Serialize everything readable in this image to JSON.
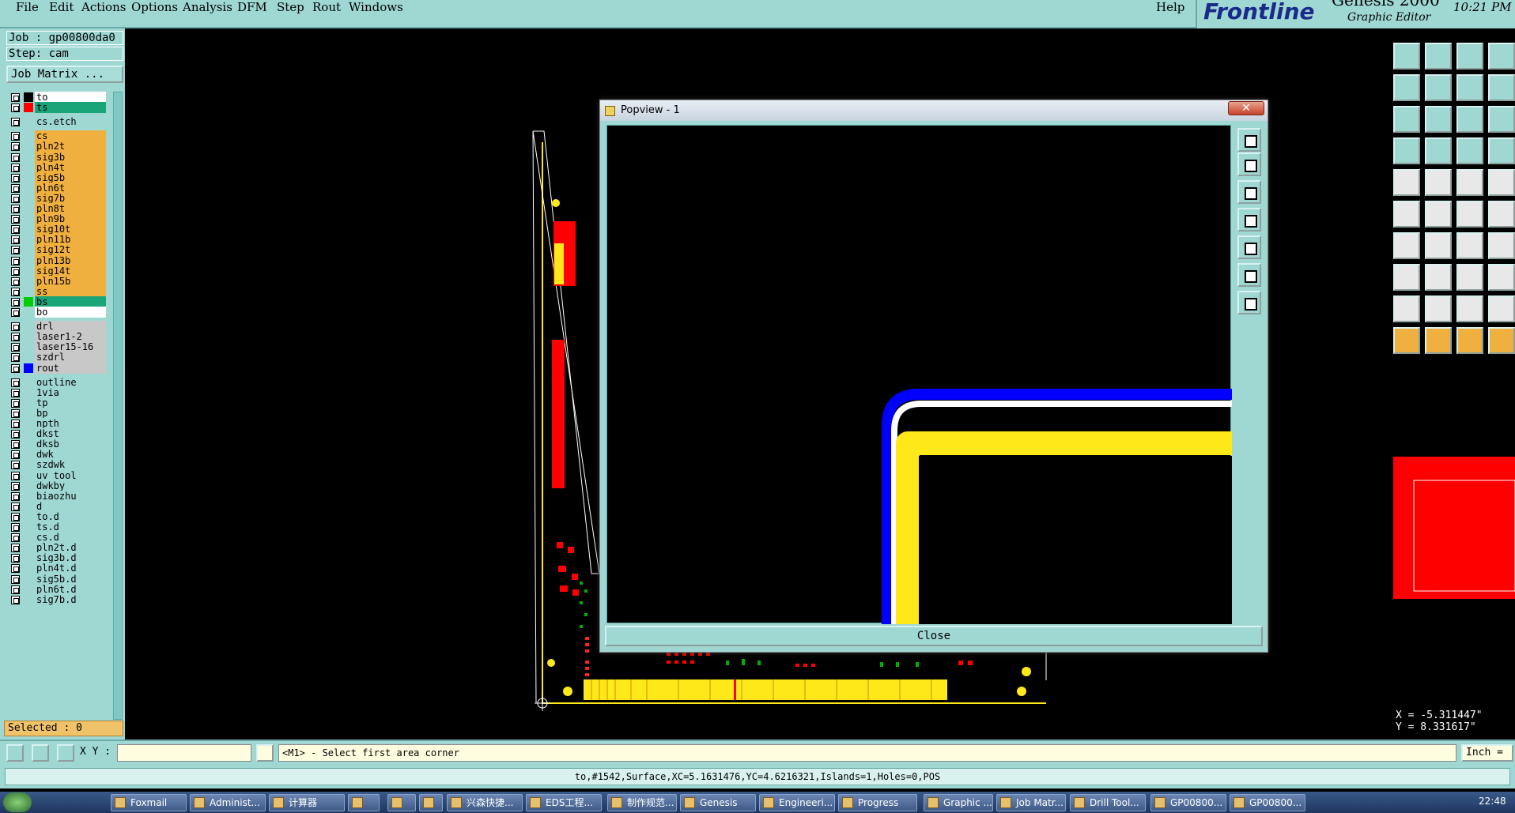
{
  "menu": {
    "items": [
      "File",
      "Edit",
      "Actions",
      "Options",
      "Analysis",
      "DFM",
      "Step",
      "Rout",
      "Windows"
    ],
    "help": "Help"
  },
  "brand": {
    "logo": "Frontline",
    "product": "Genesis 2000",
    "subtitle": "Graphic Editor",
    "clock": "10:21 PM"
  },
  "left": {
    "job": "Job : gp00800da0",
    "step": "Step: cam",
    "job_matrix": "Job Matrix ...",
    "selected": "Selected : 0",
    "layers": [
      {
        "name": "to",
        "bg": "#ffffff",
        "color": "#000000"
      },
      {
        "name": "ts",
        "bg": "#1aa579",
        "color": "#ff0000"
      },
      {
        "name": "cs.etch",
        "bg": "#9fd7d3",
        "color": ""
      },
      {
        "name": "cs",
        "bg": "#f0b040",
        "color": ""
      },
      {
        "name": "pln2t",
        "bg": "#f0b040",
        "color": ""
      },
      {
        "name": "sig3b",
        "bg": "#f0b040",
        "color": ""
      },
      {
        "name": "pln4t",
        "bg": "#f0b040",
        "color": ""
      },
      {
        "name": "sig5b",
        "bg": "#f0b040",
        "color": ""
      },
      {
        "name": "pln6t",
        "bg": "#f0b040",
        "color": ""
      },
      {
        "name": "sig7b",
        "bg": "#f0b040",
        "color": ""
      },
      {
        "name": "pln8t",
        "bg": "#f0b040",
        "color": ""
      },
      {
        "name": "pln9b",
        "bg": "#f0b040",
        "color": ""
      },
      {
        "name": "sig10t",
        "bg": "#f0b040",
        "color": ""
      },
      {
        "name": "pln11b",
        "bg": "#f0b040",
        "color": ""
      },
      {
        "name": "sig12t",
        "bg": "#f0b040",
        "color": ""
      },
      {
        "name": "pln13b",
        "bg": "#f0b040",
        "color": ""
      },
      {
        "name": "sig14t",
        "bg": "#f0b040",
        "color": ""
      },
      {
        "name": "pln15b",
        "bg": "#f0b040",
        "color": ""
      },
      {
        "name": "ss",
        "bg": "#f0b040",
        "color": ""
      },
      {
        "name": "bs",
        "bg": "#1aa579",
        "color": "#00cc00"
      },
      {
        "name": "bo",
        "bg": "#ffffff",
        "color": ""
      },
      {
        "name": "drl",
        "bg": "#c8c8c8",
        "color": ""
      },
      {
        "name": "laser1-2",
        "bg": "#c8c8c8",
        "color": ""
      },
      {
        "name": "laser15-16",
        "bg": "#c8c8c8",
        "color": ""
      },
      {
        "name": "szdrl",
        "bg": "#c8c8c8",
        "color": ""
      },
      {
        "name": "rout",
        "bg": "#c8c8c8",
        "color": "#0000ff"
      },
      {
        "name": "outline",
        "bg": "#9fd7d3",
        "color": ""
      },
      {
        "name": "1via",
        "bg": "#9fd7d3",
        "color": ""
      },
      {
        "name": "tp",
        "bg": "#9fd7d3",
        "color": ""
      },
      {
        "name": "bp",
        "bg": "#9fd7d3",
        "color": ""
      },
      {
        "name": "npth",
        "bg": "#9fd7d3",
        "color": ""
      },
      {
        "name": "dkst",
        "bg": "#9fd7d3",
        "color": ""
      },
      {
        "name": "dksb",
        "bg": "#9fd7d3",
        "color": ""
      },
      {
        "name": "dwk",
        "bg": "#9fd7d3",
        "color": ""
      },
      {
        "name": "szdwk",
        "bg": "#9fd7d3",
        "color": ""
      },
      {
        "name": "uv_tool",
        "bg": "#9fd7d3",
        "color": ""
      },
      {
        "name": "dwkby",
        "bg": "#9fd7d3",
        "color": ""
      },
      {
        "name": "biaozhu",
        "bg": "#9fd7d3",
        "color": ""
      },
      {
        "name": "d",
        "bg": "#9fd7d3",
        "color": ""
      },
      {
        "name": "to.d",
        "bg": "#9fd7d3",
        "color": ""
      },
      {
        "name": "ts.d",
        "bg": "#9fd7d3",
        "color": ""
      },
      {
        "name": "cs.d",
        "bg": "#9fd7d3",
        "color": ""
      },
      {
        "name": "pln2t.d",
        "bg": "#9fd7d3",
        "color": ""
      },
      {
        "name": "sig3b.d",
        "bg": "#9fd7d3",
        "color": ""
      },
      {
        "name": "pln4t.d",
        "bg": "#9fd7d3",
        "color": ""
      },
      {
        "name": "sig5b.d",
        "bg": "#9fd7d3",
        "color": ""
      },
      {
        "name": "pln6t.d",
        "bg": "#9fd7d3",
        "color": ""
      },
      {
        "name": "sig7b.d",
        "bg": "#9fd7d3",
        "color": ""
      }
    ]
  },
  "popup": {
    "title": "Popview - 1",
    "close_x": "✕",
    "close_label": "Close"
  },
  "coords": {
    "x": "X = -5.311447\"",
    "y": "Y = 8.331617\""
  },
  "cmd": {
    "xy_label": "X Y :",
    "xy_value": "",
    "prompt": "<M1> - Select first area corner",
    "units": "Inch ="
  },
  "status": "to,#1542,Surface,XC=5.1631476,YC=4.6216321,Islands=1,Holes=0,POS",
  "taskbar": {
    "items": [
      "Foxmail",
      "Administ...",
      "计算器",
      "",
      "",
      "",
      "兴森快捷...",
      "EDS工程...",
      "制作规范...",
      "Genesis",
      "Engineeri...",
      "Progress",
      "Graphic ...",
      "Job Matr...",
      "Drill Tool...",
      "GP00800...",
      "GP00800..."
    ],
    "time": "22:48"
  },
  "colors": {
    "panel": "#9fd7d3",
    "accent": "#f0b040",
    "trace_yellow": "#ffe81a",
    "trace_blue": "#0000ff",
    "red": "#ff0000"
  }
}
